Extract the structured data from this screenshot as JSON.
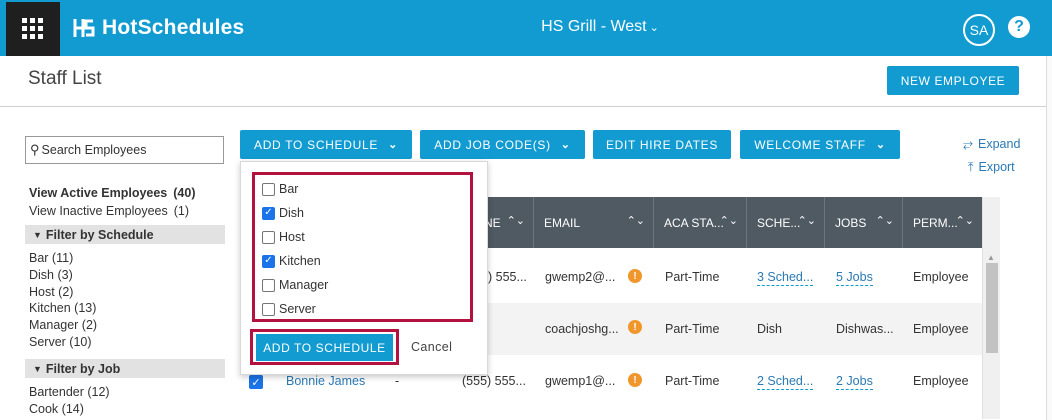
{
  "topbar": {
    "brand": "HotSchedules",
    "location": "HS Grill - West",
    "location_caret": "⌄",
    "avatar_initials": "SA",
    "help_glyph": "?",
    "color": "#119bd1"
  },
  "header": {
    "title": "Staff List",
    "new_employee_label": "NEW EMPLOYEE"
  },
  "left": {
    "search_placeholder": "Search Employees",
    "active_label": "View Active Employees",
    "active_count": "(40)",
    "inactive_label": "View Inactive Employees",
    "inactive_count": "(1)",
    "filter_schedule_label": "Filter by Schedule",
    "schedules": [
      "Bar (11)",
      "Dish (3)",
      "Host (2)",
      "Kitchen (13)",
      "Manager (2)",
      "Server (10)"
    ],
    "filter_job_label": "Filter by Job",
    "jobs": [
      "Bartender (12)",
      "Cook (14)"
    ]
  },
  "toolbar": {
    "add_to_schedule": "ADD TO SCHEDULE",
    "add_job_codes": "ADD JOB CODE(S)",
    "edit_hire_dates": "EDIT HIRE DATES",
    "welcome_staff": "WELCOME STAFF",
    "expand": "Expand",
    "export": "Export"
  },
  "dropdown": {
    "options": [
      {
        "label": "Bar",
        "checked": false
      },
      {
        "label": "Dish",
        "checked": true
      },
      {
        "label": "Host",
        "checked": false
      },
      {
        "label": "Kitchen",
        "checked": true
      },
      {
        "label": "Manager",
        "checked": false
      },
      {
        "label": "Server",
        "checked": false
      }
    ],
    "add_button": "ADD TO SCHEDULE",
    "cancel": "Cancel",
    "highlight_color": "#b3123f"
  },
  "table": {
    "columns": [
      "NE",
      "EMAIL",
      "ACA STA...",
      "SCHE...",
      "JOBS",
      "PERM..."
    ],
    "rows": [
      {
        "name": "",
        "dash": "",
        "phone": ") 555...",
        "email": "gwemp2@...",
        "aca": "Part-Time",
        "schedule": "3 Sched...",
        "jobs": "5 Jobs",
        "perm": "Employee"
      },
      {
        "name": "",
        "dash": "",
        "phone": "",
        "email": "coachjoshg...",
        "aca": "Part-Time",
        "schedule": "Dish",
        "jobs": "Dishwas...",
        "perm": "Employee"
      },
      {
        "name": "Bonnie James",
        "dash": "-",
        "phone": "(555) 555...",
        "email": "gwemp1@...",
        "aca": "Part-Time",
        "schedule": "2 Sched...",
        "jobs": "2 Jobs",
        "perm": "Employee"
      }
    ],
    "sort_glyph": "⌃⌄",
    "warn_glyph": "!"
  }
}
